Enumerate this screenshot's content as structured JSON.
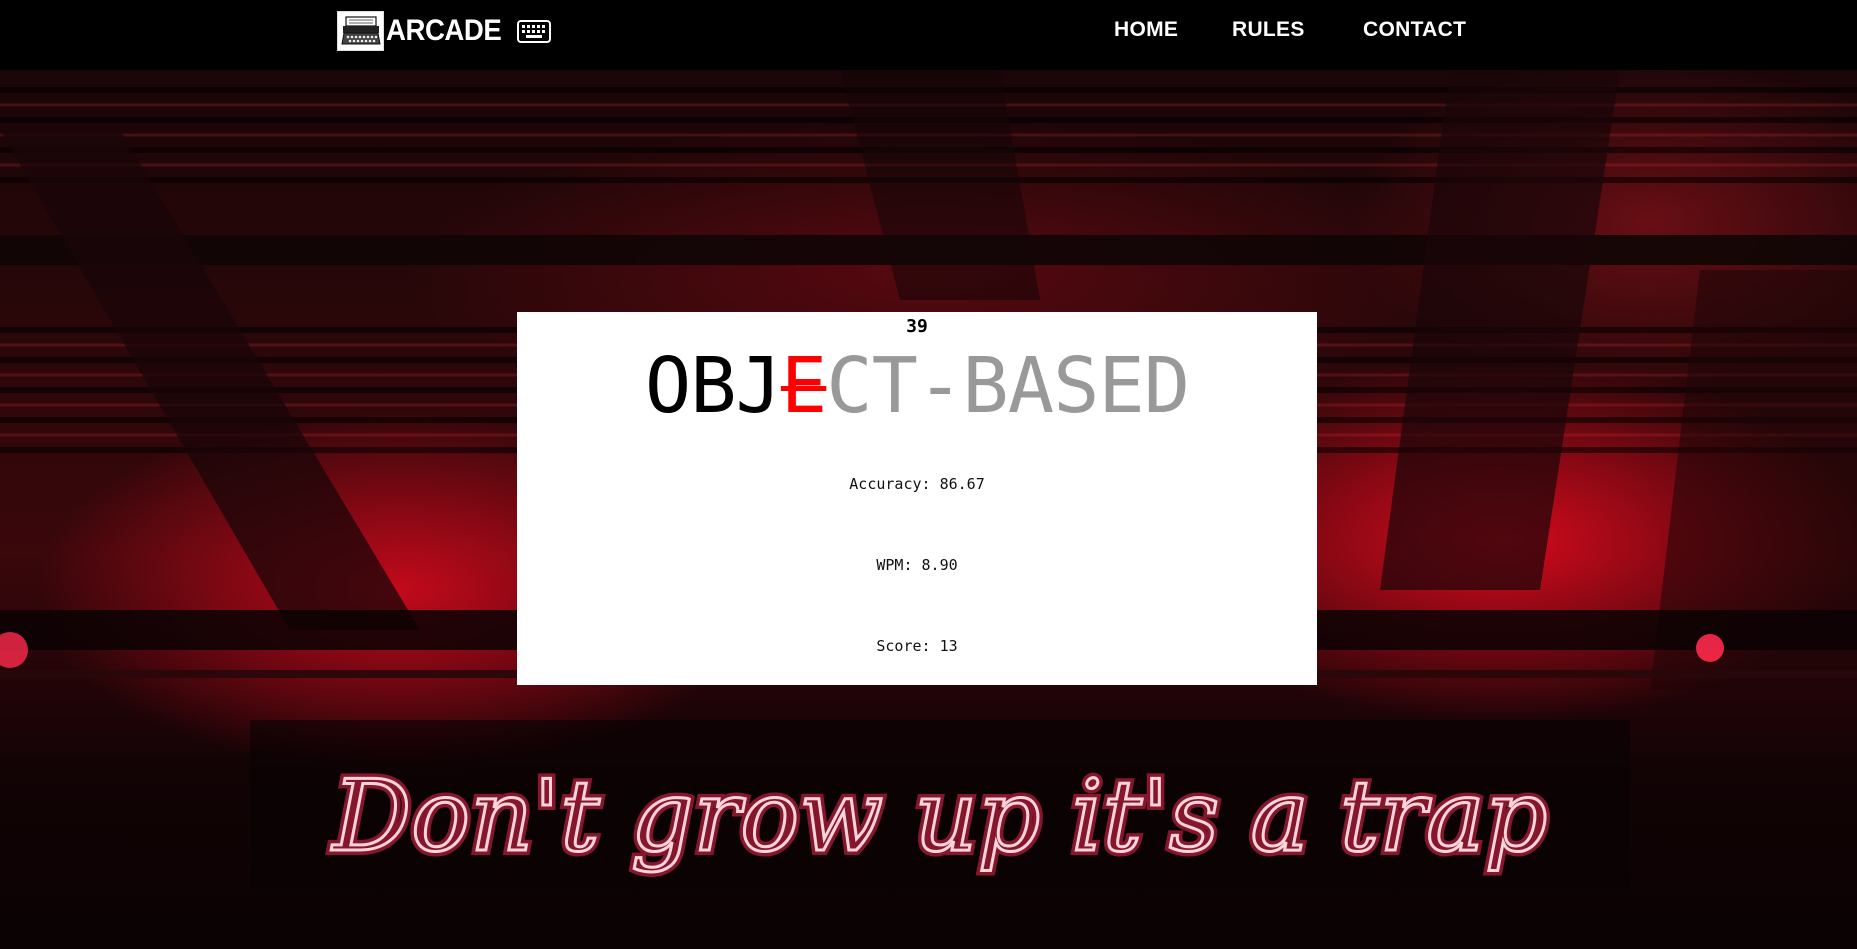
{
  "nav": {
    "brand": "ARCADE",
    "links": [
      "HOME",
      "RULES",
      "CONTACT"
    ]
  },
  "game": {
    "timer": "39",
    "word": {
      "typed": "OBJ",
      "wrong": "E",
      "rest": "CT-BASED"
    },
    "accuracy": "Accuracy: 86.67",
    "wpm": "WPM: 8.90",
    "score": "Score: 13"
  },
  "background": {
    "neon_sign": "Don't grow up it's a trap"
  },
  "colors": {
    "nav_bg": "#000000",
    "wrong_letter": "#ff0000",
    "pending_letters": "#999999",
    "neon": "#ff2d55"
  },
  "icons": [
    "typewriter-logo-icon",
    "keyboard-icon"
  ]
}
